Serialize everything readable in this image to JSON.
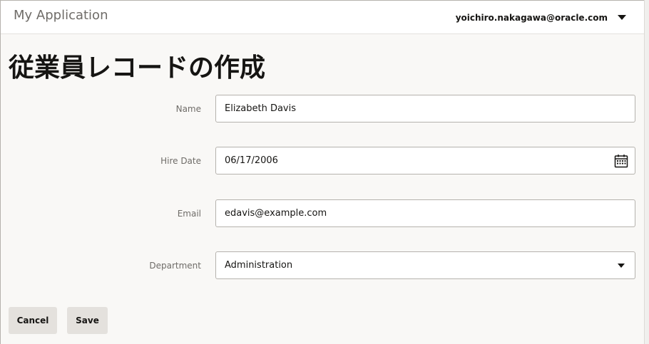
{
  "header": {
    "app_name": "My Application",
    "user_email": "yoichiro.nakagawa@oracle.com",
    "user_menu_icon": "caret-down-icon"
  },
  "page": {
    "title": "従業員レコードの作成"
  },
  "form": {
    "name": {
      "label": "Name",
      "value": "Elizabeth Davis"
    },
    "hire_date": {
      "label": "Hire Date",
      "value": "06/17/2006",
      "icon": "calendar-icon"
    },
    "email": {
      "label": "Email",
      "value": "edavis@example.com"
    },
    "department": {
      "label": "Department",
      "value": "Administration",
      "icon": "caret-down-icon"
    }
  },
  "actions": {
    "cancel_label": "Cancel",
    "save_label": "Save"
  },
  "colors": {
    "background": "#f9f8f6",
    "header_background": "#ffffff",
    "button_background": "#e4e1dd",
    "text_primary": "#161513",
    "text_secondary": "#6f6c68",
    "border": "#b5b2ad"
  }
}
